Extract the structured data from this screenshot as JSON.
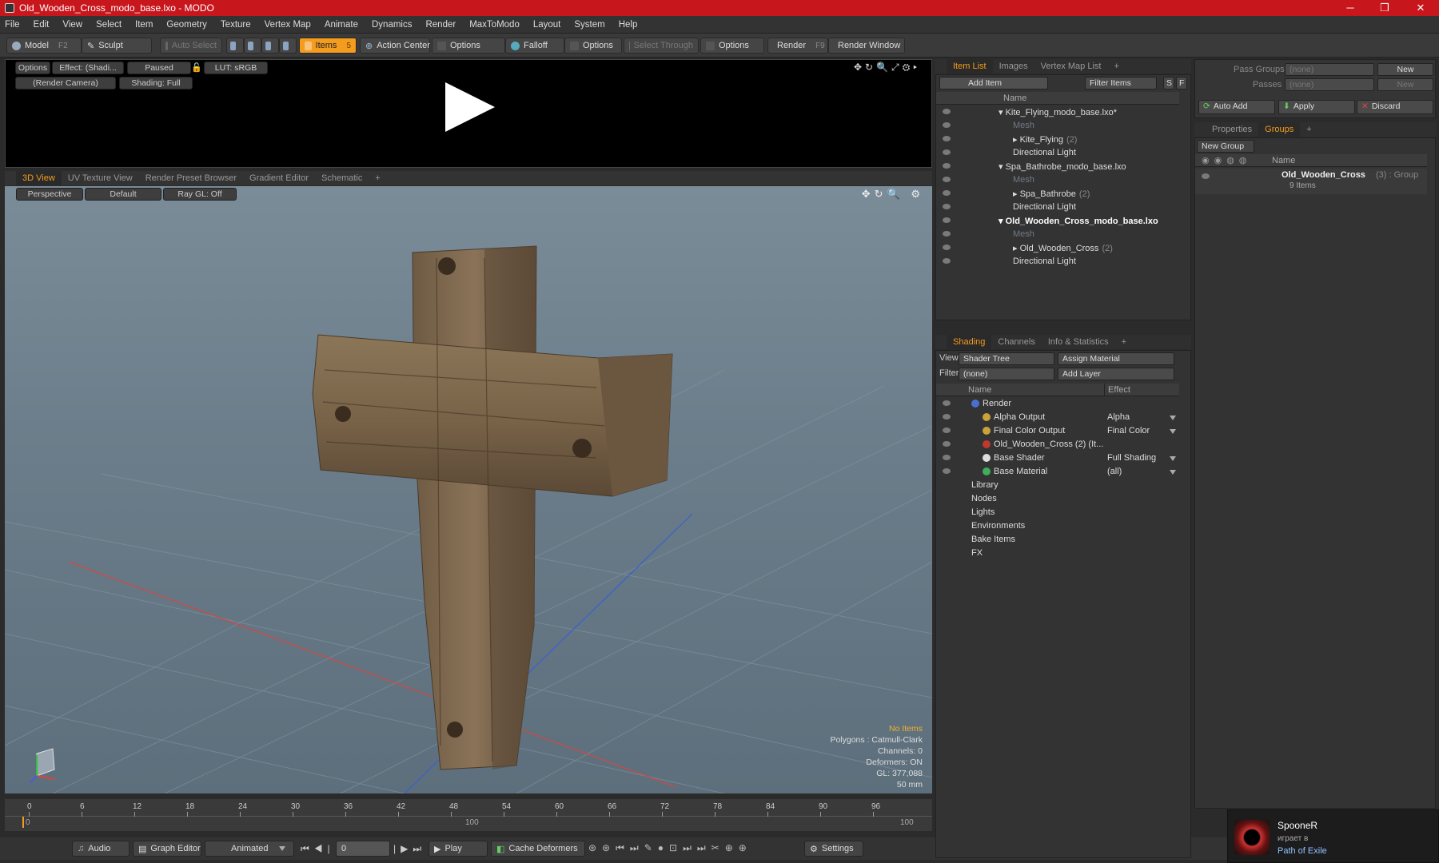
{
  "window": {
    "title": "Old_Wooden_Cross_modo_base.lxo - MODO",
    "minimize": "─",
    "maximize": "❐",
    "close": "✕"
  },
  "menu": [
    "File",
    "Edit",
    "View",
    "Select",
    "Item",
    "Geometry",
    "Texture",
    "Vertex Map",
    "Animate",
    "Dynamics",
    "Render",
    "MaxToModo",
    "Layout",
    "System",
    "Help"
  ],
  "toolbar": {
    "model": "Model",
    "model_key": "F2",
    "sculpt": "Sculpt",
    "auto_select": "Auto Select",
    "items": "Items",
    "items_key": "5",
    "action_center": "Action Center",
    "options1": "Options",
    "falloff": "Falloff",
    "options2": "Options",
    "select_through": "Select Through",
    "options3": "Options",
    "render": "Render",
    "render_key": "F9",
    "render_window": "Render Window"
  },
  "preview": {
    "options": "Options",
    "effect": "Effect: (Shadi...",
    "paused": "Paused",
    "lut": "LUT: sRGB",
    "camera": "(Render Camera)",
    "shading": "Shading: Full"
  },
  "viewtabs": [
    "3D View",
    "UV Texture View",
    "Render Preset Browser",
    "Gradient Editor",
    "Schematic"
  ],
  "viewport": {
    "perspective": "Perspective",
    "default": "Default",
    "raygl": "Ray GL: Off"
  },
  "stats": {
    "items": "No Items",
    "polygons": "Polygons : Catmull-Clark",
    "channels": "Channels: 0",
    "deformers": "Deformers: ON",
    "gl": "GL: 377,088",
    "mm": "50 mm"
  },
  "timeline": {
    "ticks": [
      "0",
      "6",
      "12",
      "18",
      "24",
      "30",
      "36",
      "42",
      "48",
      "54",
      "60",
      "66",
      "72",
      "78",
      "84",
      "90",
      "96"
    ],
    "ticks2": [
      "0",
      "100",
      "100"
    ]
  },
  "bottom": {
    "audio": "Audio",
    "graph": "Graph Editor",
    "animated": "Animated",
    "frame": "0",
    "play": "Play",
    "cache": "Cache Deformers",
    "settings": "Settings"
  },
  "itemlist": {
    "tabs": [
      "Item List",
      "Images",
      "Vertex Map List"
    ],
    "add_item": "Add Item",
    "filter": "Filter Items",
    "s": "S",
    "f": "F",
    "col_name": "Name",
    "rows": [
      {
        "label": "Kite_Flying_modo_base.lxo*",
        "indent": 0,
        "bold": false,
        "dim": false,
        "count": ""
      },
      {
        "label": "Mesh",
        "indent": 1,
        "bold": false,
        "dim": true,
        "count": ""
      },
      {
        "label": "Kite_Flying",
        "indent": 1,
        "bold": false,
        "dim": false,
        "count": "(2)"
      },
      {
        "label": "Directional Light",
        "indent": 1,
        "bold": false,
        "dim": false,
        "count": ""
      },
      {
        "label": "Spa_Bathrobe_modo_base.lxo",
        "indent": 0,
        "bold": false,
        "dim": false,
        "count": ""
      },
      {
        "label": "Mesh",
        "indent": 1,
        "bold": false,
        "dim": true,
        "count": ""
      },
      {
        "label": "Spa_Bathrobe",
        "indent": 1,
        "bold": false,
        "dim": false,
        "count": "(2)"
      },
      {
        "label": "Directional Light",
        "indent": 1,
        "bold": false,
        "dim": false,
        "count": ""
      },
      {
        "label": "Old_Wooden_Cross_modo_base.lxo",
        "indent": 0,
        "bold": true,
        "dim": false,
        "count": ""
      },
      {
        "label": "Mesh",
        "indent": 1,
        "bold": false,
        "dim": true,
        "count": ""
      },
      {
        "label": "Old_Wooden_Cross",
        "indent": 1,
        "bold": false,
        "dim": false,
        "count": "(2)"
      },
      {
        "label": "Directional Light",
        "indent": 1,
        "bold": false,
        "dim": false,
        "count": ""
      }
    ]
  },
  "shading": {
    "tabs": [
      "Shading",
      "Channels",
      "Info & Statistics"
    ],
    "view_label": "View",
    "view_value": "Shader Tree",
    "assign": "Assign Material",
    "filter_label": "Filter",
    "filter_value": "(none)",
    "add_layer": "Add Layer",
    "col_name": "Name",
    "col_effect": "Effect",
    "rows": [
      {
        "label": "Render",
        "effect": "",
        "indent": 0,
        "icon": "#4a6fd0"
      },
      {
        "label": "Alpha Output",
        "effect": "Alpha",
        "indent": 1,
        "icon": "#c9a23a"
      },
      {
        "label": "Final Color Output",
        "effect": "Final Color",
        "indent": 1,
        "icon": "#c9a23a"
      },
      {
        "label": "Old_Wooden_Cross (2) (It...",
        "effect": "",
        "indent": 1,
        "icon": "#c0392b"
      },
      {
        "label": "Base Shader",
        "effect": "Full Shading",
        "indent": 1,
        "icon": "#dddddd"
      },
      {
        "label": "Base Material",
        "effect": "(all)",
        "indent": 1,
        "icon": "#3fae5a"
      },
      {
        "label": "Library",
        "effect": "",
        "indent": 0,
        "icon": ""
      },
      {
        "label": "Nodes",
        "effect": "",
        "indent": 0,
        "icon": ""
      },
      {
        "label": "Lights",
        "effect": "",
        "indent": 0,
        "icon": ""
      },
      {
        "label": "Environments",
        "effect": "",
        "indent": 0,
        "icon": ""
      },
      {
        "label": "Bake Items",
        "effect": "",
        "indent": 0,
        "icon": ""
      },
      {
        "label": "FX",
        "effect": "",
        "indent": 0,
        "icon": ""
      }
    ]
  },
  "groups": {
    "pass_groups": "Pass Groups",
    "passes": "Passes",
    "none": "(none)",
    "new": "New",
    "auto_add": "Auto Add",
    "apply": "Apply",
    "discard": "Discard",
    "tabs": [
      "Properties",
      "Groups"
    ],
    "new_group": "New Group",
    "col_name": "Name",
    "item_name": "Old_Wooden_Cross",
    "item_count": "(3) : Group",
    "item_sub": "9 Items"
  },
  "toast": {
    "user": "SpooneR",
    "status": "играет в",
    "game": "Path of Exile"
  },
  "colors": {
    "accent": "#f39c1e",
    "titlebar": "#c8161d"
  }
}
